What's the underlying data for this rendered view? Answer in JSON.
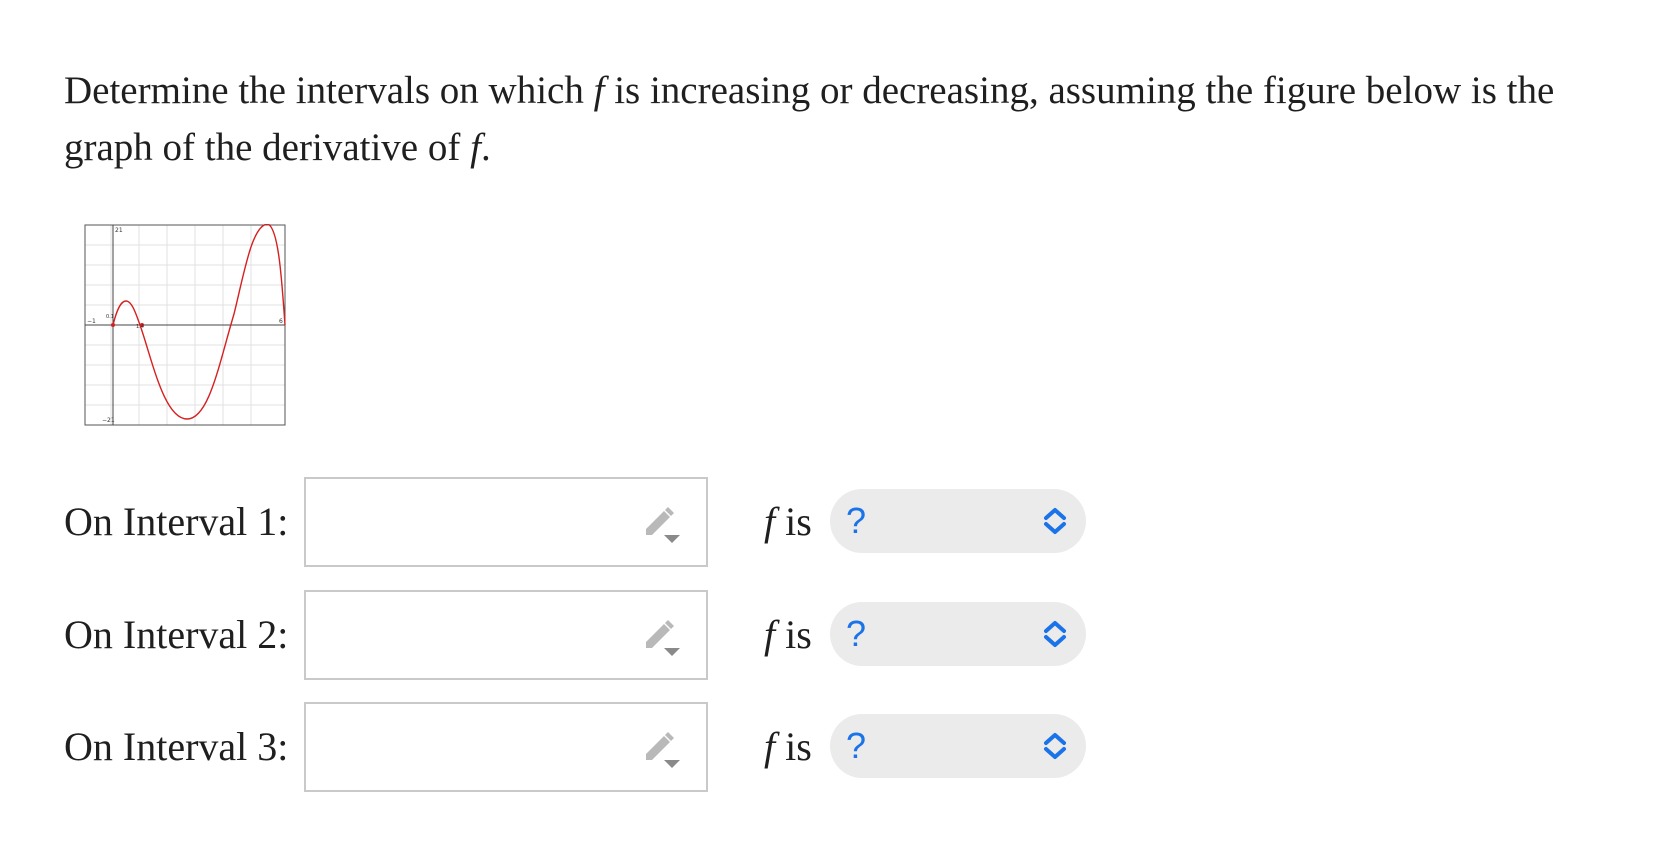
{
  "question": {
    "part1": "Determine the intervals on which",
    "f1": "f",
    "part2": "is increasing or decreasing, assuming the figure below is the graph of the derivative of",
    "f2": "f",
    "end": "."
  },
  "graph": {
    "axis_labels": {
      "x_min": "−1",
      "x_max": "6",
      "y_max": "21",
      "y_min": "−21",
      "point_label_1": "0.1",
      "point_label_2": "1.4"
    },
    "curve_color": "#d62020"
  },
  "rows": [
    {
      "label": "On Interval 1:",
      "input_value": "",
      "f": "f",
      "is_text": "is",
      "select_value": "?"
    },
    {
      "label": "On Interval 2:",
      "input_value": "",
      "f": "f",
      "is_text": "is",
      "select_value": "?"
    },
    {
      "label": "On Interval 3:",
      "input_value": "",
      "f": "f",
      "is_text": "is",
      "select_value": "?"
    }
  ],
  "icons": {
    "pencil": "pencil-dropdown-icon",
    "chevron": "chevron-up-down-icon"
  },
  "colors": {
    "accent": "#1a73e8",
    "pill_bg": "#ebebeb",
    "input_border": "#c9c9c9"
  }
}
